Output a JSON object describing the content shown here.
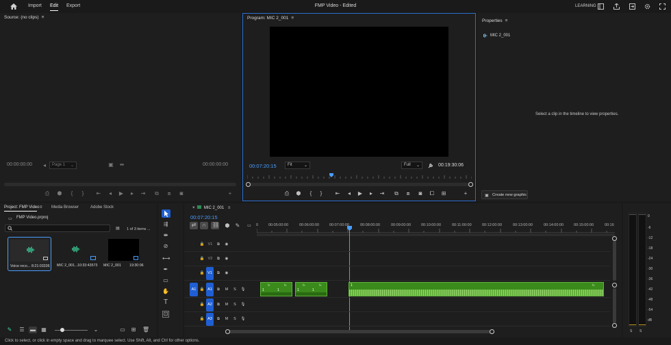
{
  "titlebar": {
    "menu": {
      "home_icon": "home-icon",
      "import": "Import",
      "edit": "Edit",
      "export": "Export"
    },
    "title": "FMP Video - Edited",
    "workspace": "LEARNING"
  },
  "source": {
    "title": "Source: (no clips)",
    "tc_in": "00:00:00:00",
    "page": "Page 1",
    "tc_out": "00:00:00:00"
  },
  "program": {
    "title": "Program: MIC 2_001",
    "tc_current": "00:07:20:15",
    "fit": "Fit",
    "quality": "Full",
    "tc_duration": "00:19:30:06",
    "playhead_fraction": 0.376
  },
  "properties": {
    "title": "Properties",
    "clip": "MIC 2_001",
    "hint": "Select a clip in the timeline to view properties.",
    "create_button": "Create new graphic"
  },
  "project": {
    "tabs": [
      "Project: FMP Video",
      "Media Browser",
      "Adobe Stock"
    ],
    "file": "FMP Video.prproj",
    "count": "1 of 3 items ...",
    "items": [
      {
        "name": "Voice reco...",
        "duration": "8:21:03336",
        "kind": "audio"
      },
      {
        "name": "MIC 2_001...",
        "duration": "10:33:43573",
        "kind": "audio"
      },
      {
        "name": "MIC 2_001",
        "duration": "19:30:06",
        "kind": "video"
      }
    ]
  },
  "timeline": {
    "tab": "MIC 2_001",
    "timecode": "00:07:20:15",
    "ruler": [
      "0",
      "00:05:00:00",
      "00:06:00:00",
      "00:07:00:00",
      "00:08:00:00",
      "00:09:00:00",
      "00:10:00:00",
      "00:11:00:00",
      "00:12:00:00",
      "00:13:00:00",
      "00:14:00:00",
      "00:15:00:00",
      "00:16"
    ],
    "tracks": [
      {
        "id": "V1",
        "label": "V1",
        "type": "video"
      },
      {
        "id": "V2",
        "label": "V2",
        "type": "video"
      },
      {
        "id": "V3",
        "label": "V1",
        "type": "video"
      },
      {
        "id": "A1",
        "label": "A1",
        "type": "audio"
      },
      {
        "id": "A2",
        "label": "A2",
        "type": "audio"
      },
      {
        "id": "A3",
        "label": "A3",
        "type": "audio"
      }
    ],
    "clip_labels": [
      "1",
      "1",
      "1",
      "1",
      "1"
    ],
    "clip_fx": "fx"
  },
  "meter": {
    "scale": [
      "0",
      "-6",
      "-12",
      "-18",
      "-24",
      "-30",
      "-36",
      "-42",
      "-48",
      "-54",
      "dB"
    ],
    "solo": [
      "S",
      "S"
    ]
  },
  "statusbar": {
    "text": "Click to select, or click in empty space and drag to marquee select. Use Shift, Alt, and Ctrl for other options."
  },
  "colors": {
    "accent": "#4a9eff",
    "clip_green": "#3a8a1c",
    "target_blue": "#1f5fd3",
    "highlight": "#2d6fd0"
  }
}
